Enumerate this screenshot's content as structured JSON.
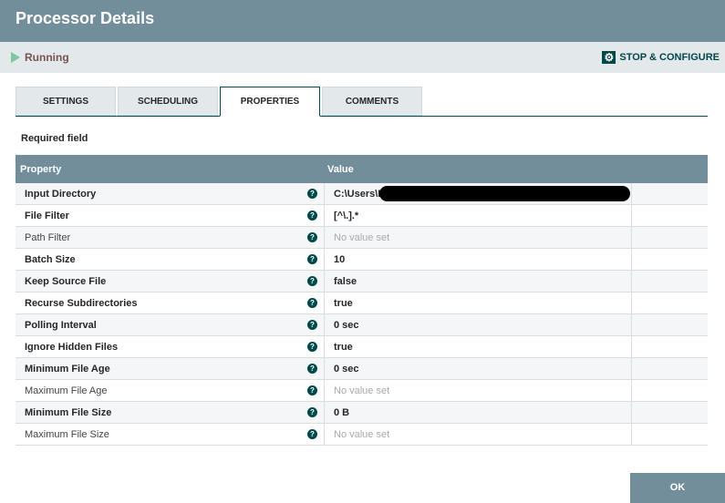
{
  "title": "Processor Details",
  "status": "Running",
  "stop_configure": "STOP & CONFIGURE",
  "tabs": [
    "SETTINGS",
    "SCHEDULING",
    "PROPERTIES",
    "COMMENTS"
  ],
  "required_label": "Required field",
  "table": {
    "headers": [
      "Property",
      "Value"
    ],
    "rows": [
      {
        "name": "Input Directory",
        "value": "C:\\Users\\B",
        "required": true
      },
      {
        "name": "File Filter",
        "value": "[^\\.].*",
        "required": true
      },
      {
        "name": "Path Filter",
        "value": "No value set",
        "required": false
      },
      {
        "name": "Batch Size",
        "value": "10",
        "required": true
      },
      {
        "name": "Keep Source File",
        "value": "false",
        "required": true
      },
      {
        "name": "Recurse Subdirectories",
        "value": "true",
        "required": true
      },
      {
        "name": "Polling Interval",
        "value": "0 sec",
        "required": true
      },
      {
        "name": "Ignore Hidden Files",
        "value": "true",
        "required": true
      },
      {
        "name": "Minimum File Age",
        "value": "0 sec",
        "required": true
      },
      {
        "name": "Maximum File Age",
        "value": "No value set",
        "required": false
      },
      {
        "name": "Minimum File Size",
        "value": "0 B",
        "required": true
      },
      {
        "name": "Maximum File Size",
        "value": "No value set",
        "required": false
      }
    ]
  },
  "ok": "OK"
}
